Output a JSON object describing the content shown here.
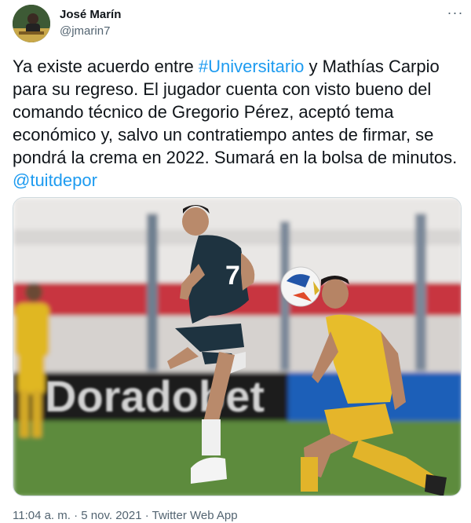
{
  "author": {
    "name": "José Marín",
    "handle": "@jmarin7"
  },
  "tweet": {
    "text_before": "Ya existe acuerdo entre ",
    "hashtag": "#Universitario",
    "text_after": " y Mathías Carpio para su regreso. El jugador cuenta con visto bueno del comando técnico de Gregorio Pérez, aceptó tema económico y, salvo un contratiempo antes de firmar, se pondrá la crema en 2022. Sumará en la bolsa de minutos. ",
    "mention": "@tuitdepor"
  },
  "media": {
    "banner_text": "Doradobet",
    "jersey_number": "7"
  },
  "meta": {
    "time": "11:04 a. m.",
    "separator": " · ",
    "date": "5 nov. 2021",
    "source": "Twitter Web App"
  },
  "colors": {
    "link": "#1d9bf0",
    "secondary_text": "#536471"
  }
}
